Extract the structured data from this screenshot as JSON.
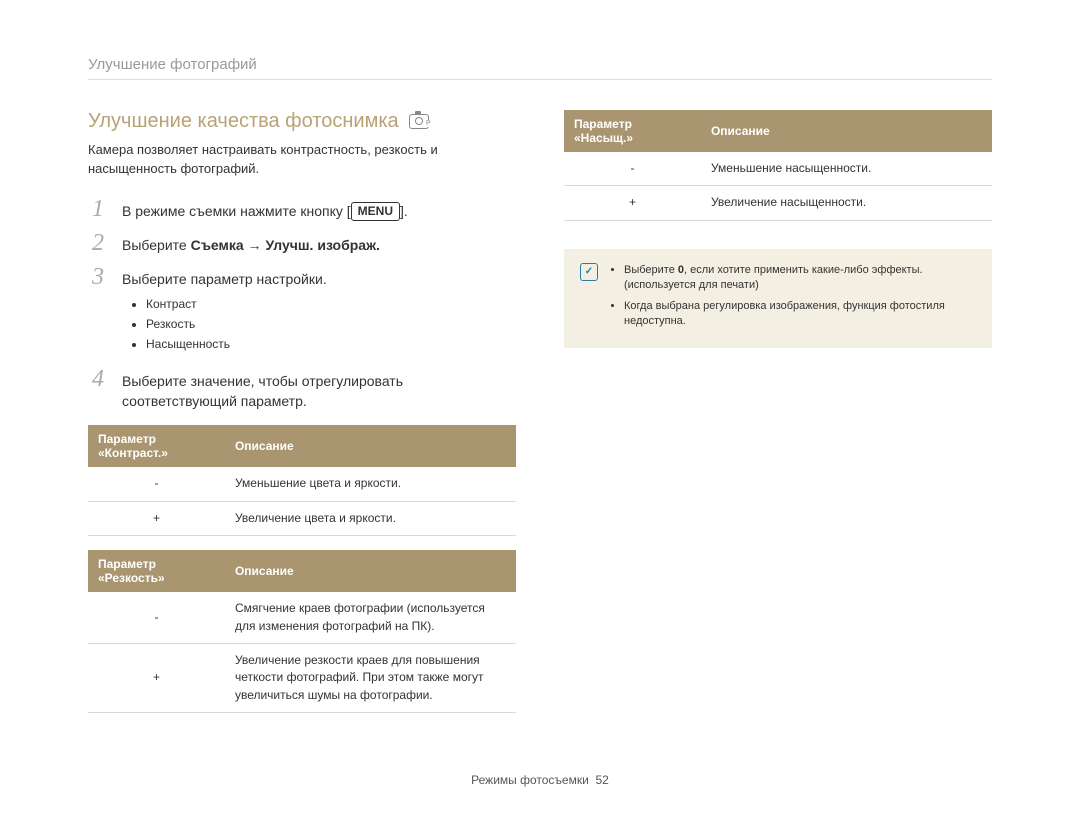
{
  "header": {
    "title": "Улучшение фотографий"
  },
  "section": {
    "title": "Улучшение качества фотоснимка",
    "intro": "Камера позволяет настраивать контрастность, резкость и насыщенность фотографий."
  },
  "steps": [
    {
      "pre": "В режиме съемки нажмите кнопку [",
      "menu": "MENU",
      "post": "]."
    },
    {
      "text_pre": "Выберите ",
      "bold": "Съемка → Улучш. изображ."
    },
    {
      "text": "Выберите параметр настройки.",
      "bullets": [
        "Контраст",
        "Резкость",
        "Насыщенность"
      ]
    },
    {
      "text": "Выберите значение, чтобы отрегулировать соответствующий параметр."
    }
  ],
  "tables": {
    "contrast": {
      "header_param": "Параметр «Контраст.»",
      "header_desc": "Описание",
      "rows": [
        {
          "symbol": "-",
          "desc": "Уменьшение цвета и яркости."
        },
        {
          "symbol": "+",
          "desc": "Увеличение цвета и яркости."
        }
      ]
    },
    "sharpness": {
      "header_param": "Параметр «Резкость»",
      "header_desc": "Описание",
      "rows": [
        {
          "symbol": "-",
          "desc": "Смягчение краев фотографии (используется для изменения фотографий на ПК)."
        },
        {
          "symbol": "+",
          "desc": "Увеличение резкости краев для повышения четкости фотографий. При этом также могут увеличиться шумы на фотографии."
        }
      ]
    },
    "saturation": {
      "header_param": "Параметр «Насыщ.»",
      "header_desc": "Описание",
      "rows": [
        {
          "symbol": "-",
          "desc": "Уменьшение насыщенности."
        },
        {
          "symbol": "+",
          "desc": "Увеличение насыщенности."
        }
      ]
    }
  },
  "note": {
    "items": [
      {
        "pre": "Выберите ",
        "bold": "0",
        "post": ", если хотите применить какие-либо эффекты. (используется для печати)"
      },
      {
        "text": "Когда выбрана регулировка изображения, функция фотостиля недоступна."
      }
    ]
  },
  "footer": {
    "text": "Режимы фотосъемки",
    "page": "52"
  }
}
